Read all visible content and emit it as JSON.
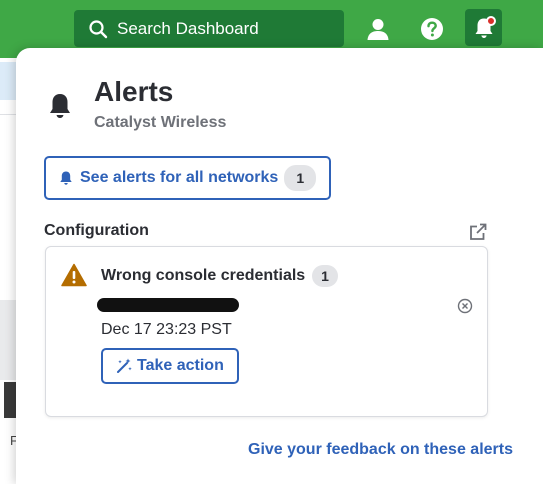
{
  "topbar": {
    "search_placeholder": "Search Dashboard",
    "icons": [
      "search-icon",
      "user-icon",
      "help-icon",
      "bell-icon"
    ],
    "notification_dot_color": "#d9302b",
    "bar_color": "#3fa846"
  },
  "background": {
    "edge_text": "F"
  },
  "panel": {
    "title": "Alerts",
    "subtitle": "Catalyst Wireless",
    "all_networks_label": "See alerts for all networks",
    "all_networks_count": "1",
    "section_title": "Configuration",
    "alert": {
      "title": "Wrong console credentials",
      "count": "1",
      "timestamp": "Dec 17 23:23 PST",
      "action_label": "Take action",
      "severity_color": "#b46d00"
    },
    "feedback_label": "Give your feedback on these alerts",
    "accent_color": "#2f62b8"
  }
}
